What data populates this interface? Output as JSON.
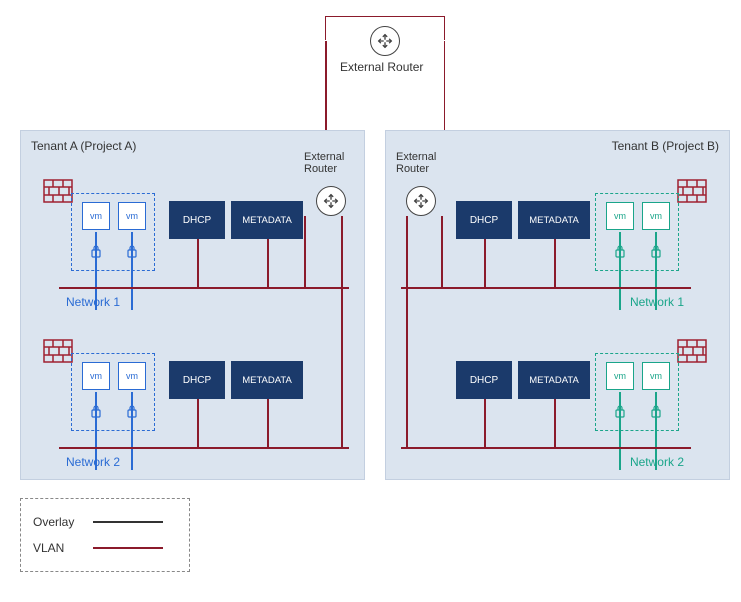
{
  "external_router": {
    "label": "External Router"
  },
  "tenants": {
    "a": {
      "title": "Tenant A (Project A)",
      "sub_router_label": "External Router",
      "vm_label": "vm",
      "dhcp_label": "DHCP",
      "metadata_label": "METADATA",
      "network1_label": "Network 1",
      "network2_label": "Network 2"
    },
    "b": {
      "title": "Tenant B (Project B)",
      "sub_router_label": "External Router",
      "vm_label": "vm",
      "dhcp_label": "DHCP",
      "metadata_label": "METADATA",
      "network1_label": "Network 1",
      "network2_label": "Network 2"
    }
  },
  "legend": {
    "overlay": "Overlay",
    "vlan": "VLAN"
  },
  "colors": {
    "tenant_a_accent": "#2a6bd4",
    "tenant_b_accent": "#1aa58a",
    "wire": "#8b1a2b",
    "panel_bg": "#dbe4ef",
    "service_bg": "#1b3a6b"
  }
}
